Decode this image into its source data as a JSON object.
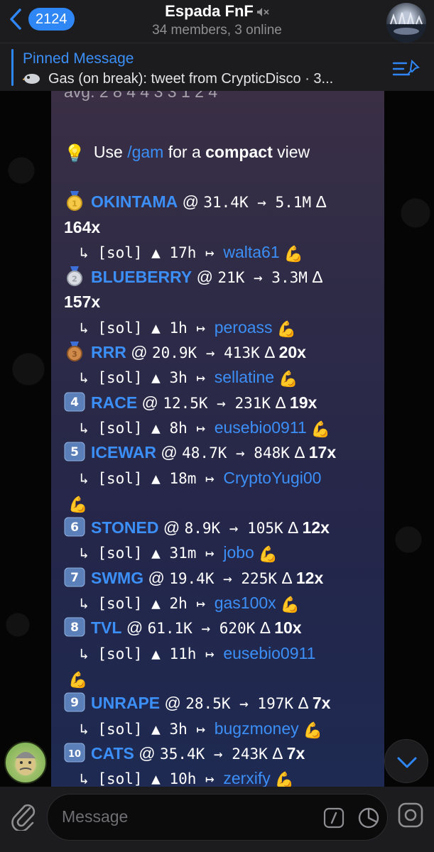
{
  "header": {
    "back_count": "2124",
    "title": "Espada FnF",
    "subtitle": "34 members, 3 online"
  },
  "pinned": {
    "title": "Pinned Message",
    "text": "Gas (on break): tweet from CrypticDisco · 3..."
  },
  "message": {
    "top_partial": "avg. 2 8 4 4 3 3 1 2 4",
    "tip": {
      "prefix": "Use ",
      "command": "/gam",
      "middle": " for a ",
      "bold": "compact",
      "suffix": " view"
    },
    "entries": [
      {
        "rank": "1",
        "ticker": "OKINTAMA",
        "entry": "31.4K",
        "ath": "5.1M",
        "mult": "164x",
        "chain": "[sol]",
        "age": "17h",
        "user": "walta61",
        "wrap_mult": true,
        "wrap_user": false
      },
      {
        "rank": "2",
        "ticker": "BLUEBERRY",
        "entry": "21K",
        "ath": "3.3M",
        "mult": "157x",
        "chain": "[sol]",
        "age": "1h",
        "user": "peroass",
        "wrap_mult": true,
        "wrap_user": false
      },
      {
        "rank": "3",
        "ticker": "RRR",
        "entry": "20.9K",
        "ath": "413K",
        "mult": "20x",
        "chain": "[sol]",
        "age": "3h",
        "user": "sellatine",
        "wrap_mult": false,
        "wrap_user": false
      },
      {
        "rank": "4",
        "ticker": "RACE",
        "entry": "12.5K",
        "ath": "231K",
        "mult": "19x",
        "chain": "[sol]",
        "age": "8h",
        "user": "eusebio0911",
        "wrap_mult": false,
        "wrap_user": false
      },
      {
        "rank": "5",
        "ticker": "ICEWAR",
        "entry": "48.7K",
        "ath": "848K",
        "mult": "17x",
        "chain": "[sol]",
        "age": "18m",
        "user": "CryptoYugi00",
        "wrap_mult": false,
        "wrap_user": true
      },
      {
        "rank": "6",
        "ticker": "STONED",
        "entry": "8.9K",
        "ath": "105K",
        "mult": "12x",
        "chain": "[sol]",
        "age": "31m",
        "user": "jobo",
        "wrap_mult": false,
        "wrap_user": false
      },
      {
        "rank": "7",
        "ticker": "SWMG",
        "entry": "19.4K",
        "ath": "225K",
        "mult": "12x",
        "chain": "[sol]",
        "age": "2h",
        "user": "gas100x",
        "wrap_mult": false,
        "wrap_user": false
      },
      {
        "rank": "8",
        "ticker": "TVL",
        "entry": "61.1K",
        "ath": "620K",
        "mult": "10x",
        "chain": "[sol]",
        "age": "11h",
        "user": "eusebio0911",
        "wrap_mult": false,
        "wrap_user": true
      },
      {
        "rank": "9",
        "ticker": "UNRAPE",
        "entry": "28.5K",
        "ath": "197K",
        "mult": "7x",
        "chain": "[sol]",
        "age": "3h",
        "user": "bugzmoney",
        "wrap_mult": false,
        "wrap_user": false
      },
      {
        "rank": "10",
        "ticker": "CATS",
        "entry": "35.4K",
        "ath": "243K",
        "mult": "7x",
        "chain": "[sol]",
        "age": "10h",
        "user": "zerxify",
        "wrap_mult": false,
        "wrap_user": false
      }
    ]
  },
  "input": {
    "placeholder": "Message"
  },
  "icons": {
    "back": "chevron-left-icon",
    "mute": "muted-speaker-icon",
    "pinned": "pin-list-icon",
    "attach": "paperclip-icon",
    "command": "slash-command-icon",
    "sticker": "sticker-icon",
    "camera": "camera-icon",
    "scroll": "chevron-down-icon",
    "muscle": "flexed-biceps-emoji"
  },
  "colors": {
    "accent": "#2f86f5",
    "link": "#3c8ff7",
    "header_bg": "#1c1c1e",
    "background": "#050505"
  }
}
